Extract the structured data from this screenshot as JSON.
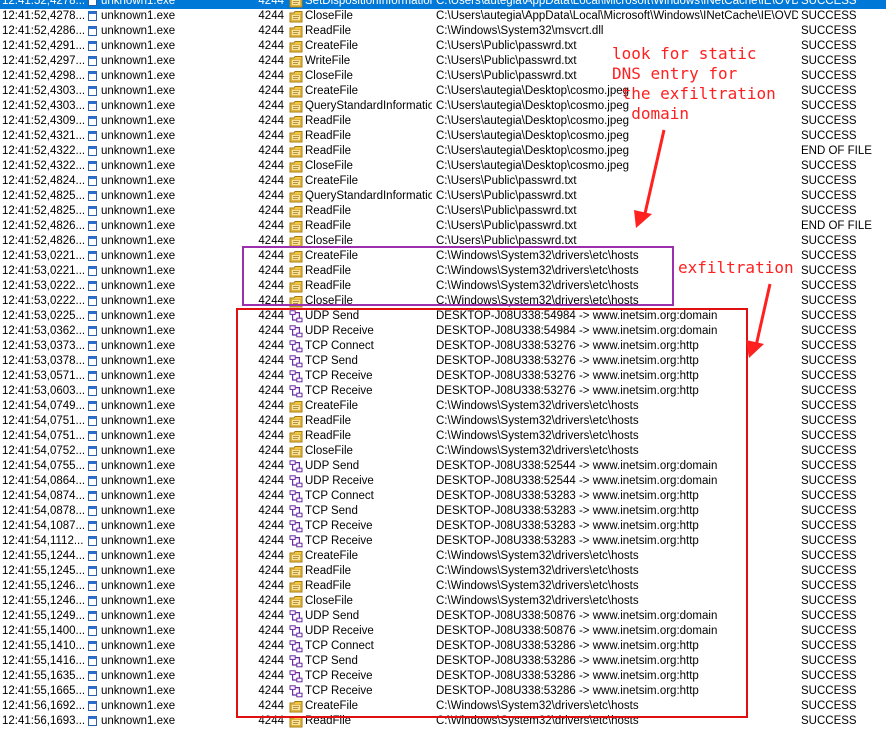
{
  "colors": {
    "selection": "#0078d7",
    "annotation": "#ff2020",
    "purple_box": "#9b2fae",
    "red_box": "#e01010"
  },
  "annotations": {
    "static_dns_note": "look for static\nDNS entry for\n the exfiltration\n  domain",
    "exfiltration_note": "exfiltration"
  },
  "events": [
    {
      "time": "12:41:52,4278...",
      "process": "unknown1.exe",
      "pid": "4244",
      "operation": "SetDispositionInformationEx",
      "path": "C:\\Users\\autegia\\AppData\\Local\\Microsoft\\Windows\\INetCache\\IE\\OVD...",
      "result": "SUCCESS",
      "icon": "file-icon",
      "selected": true
    },
    {
      "time": "12:41:52,4278...",
      "process": "unknown1.exe",
      "pid": "4244",
      "operation": "CloseFile",
      "path": "C:\\Users\\autegia\\AppData\\Local\\Microsoft\\Windows\\INetCache\\IE\\OVD...",
      "result": "SUCCESS",
      "icon": "file-icon"
    },
    {
      "time": "12:41:52,4286...",
      "process": "unknown1.exe",
      "pid": "4244",
      "operation": "ReadFile",
      "path": "C:\\Windows\\System32\\msvcrt.dll",
      "result": "SUCCESS",
      "icon": "file-icon"
    },
    {
      "time": "12:41:52,4291...",
      "process": "unknown1.exe",
      "pid": "4244",
      "operation": "CreateFile",
      "path": "C:\\Users\\Public\\passwrd.txt",
      "result": "SUCCESS",
      "icon": "file-icon"
    },
    {
      "time": "12:41:52,4297...",
      "process": "unknown1.exe",
      "pid": "4244",
      "operation": "WriteFile",
      "path": "C:\\Users\\Public\\passwrd.txt",
      "result": "SUCCESS",
      "icon": "file-icon"
    },
    {
      "time": "12:41:52,4298...",
      "process": "unknown1.exe",
      "pid": "4244",
      "operation": "CloseFile",
      "path": "C:\\Users\\Public\\passwrd.txt",
      "result": "SUCCESS",
      "icon": "file-icon"
    },
    {
      "time": "12:41:52,4303...",
      "process": "unknown1.exe",
      "pid": "4244",
      "operation": "CreateFile",
      "path": "C:\\Users\\autegia\\Desktop\\cosmo.jpeg",
      "result": "SUCCESS",
      "icon": "file-icon"
    },
    {
      "time": "12:41:52,4303...",
      "process": "unknown1.exe",
      "pid": "4244",
      "operation": "QueryStandardInformatio...",
      "path": "C:\\Users\\autegia\\Desktop\\cosmo.jpeg",
      "result": "SUCCESS",
      "icon": "file-icon"
    },
    {
      "time": "12:41:52,4309...",
      "process": "unknown1.exe",
      "pid": "4244",
      "operation": "ReadFile",
      "path": "C:\\Users\\autegia\\Desktop\\cosmo.jpeg",
      "result": "SUCCESS",
      "icon": "file-icon"
    },
    {
      "time": "12:41:52,4321...",
      "process": "unknown1.exe",
      "pid": "4244",
      "operation": "ReadFile",
      "path": "C:\\Users\\autegia\\Desktop\\cosmo.jpeg",
      "result": "SUCCESS",
      "icon": "file-icon"
    },
    {
      "time": "12:41:52,4322...",
      "process": "unknown1.exe",
      "pid": "4244",
      "operation": "ReadFile",
      "path": "C:\\Users\\autegia\\Desktop\\cosmo.jpeg",
      "result": "END OF FILE",
      "icon": "file-icon"
    },
    {
      "time": "12:41:52,4322...",
      "process": "unknown1.exe",
      "pid": "4244",
      "operation": "CloseFile",
      "path": "C:\\Users\\autegia\\Desktop\\cosmo.jpeg",
      "result": "SUCCESS",
      "icon": "file-icon"
    },
    {
      "time": "12:41:52,4824...",
      "process": "unknown1.exe",
      "pid": "4244",
      "operation": "CreateFile",
      "path": "C:\\Users\\Public\\passwrd.txt",
      "result": "SUCCESS",
      "icon": "file-icon"
    },
    {
      "time": "12:41:52,4825...",
      "process": "unknown1.exe",
      "pid": "4244",
      "operation": "QueryStandardInformatio...",
      "path": "C:\\Users\\Public\\passwrd.txt",
      "result": "SUCCESS",
      "icon": "file-icon"
    },
    {
      "time": "12:41:52,4825...",
      "process": "unknown1.exe",
      "pid": "4244",
      "operation": "ReadFile",
      "path": "C:\\Users\\Public\\passwrd.txt",
      "result": "SUCCESS",
      "icon": "file-icon"
    },
    {
      "time": "12:41:52,4826...",
      "process": "unknown1.exe",
      "pid": "4244",
      "operation": "ReadFile",
      "path": "C:\\Users\\Public\\passwrd.txt",
      "result": "END OF FILE",
      "icon": "file-icon"
    },
    {
      "time": "12:41:52,4826...",
      "process": "unknown1.exe",
      "pid": "4244",
      "operation": "CloseFile",
      "path": "C:\\Users\\Public\\passwrd.txt",
      "result": "SUCCESS",
      "icon": "file-icon"
    },
    {
      "time": "12:41:53,0221...",
      "process": "unknown1.exe",
      "pid": "4244",
      "operation": "CreateFile",
      "path": "C:\\Windows\\System32\\drivers\\etc\\hosts",
      "result": "SUCCESS",
      "icon": "file-icon"
    },
    {
      "time": "12:41:53,0221...",
      "process": "unknown1.exe",
      "pid": "4244",
      "operation": "ReadFile",
      "path": "C:\\Windows\\System32\\drivers\\etc\\hosts",
      "result": "SUCCESS",
      "icon": "file-icon"
    },
    {
      "time": "12:41:53,0222...",
      "process": "unknown1.exe",
      "pid": "4244",
      "operation": "ReadFile",
      "path": "C:\\Windows\\System32\\drivers\\etc\\hosts",
      "result": "SUCCESS",
      "icon": "file-icon"
    },
    {
      "time": "12:41:53,0222...",
      "process": "unknown1.exe",
      "pid": "4244",
      "operation": "CloseFile",
      "path": "C:\\Windows\\System32\\drivers\\etc\\hosts",
      "result": "SUCCESS",
      "icon": "file-icon"
    },
    {
      "time": "12:41:53,0225...",
      "process": "unknown1.exe",
      "pid": "4244",
      "operation": "UDP Send",
      "path": "DESKTOP-J08U338:54984 -> www.inetsim.org:domain",
      "result": "SUCCESS",
      "icon": "network-icon"
    },
    {
      "time": "12:41:53,0362...",
      "process": "unknown1.exe",
      "pid": "4244",
      "operation": "UDP Receive",
      "path": "DESKTOP-J08U338:54984 -> www.inetsim.org:domain",
      "result": "SUCCESS",
      "icon": "network-icon"
    },
    {
      "time": "12:41:53,0373...",
      "process": "unknown1.exe",
      "pid": "4244",
      "operation": "TCP Connect",
      "path": "DESKTOP-J08U338:53276 -> www.inetsim.org:http",
      "result": "SUCCESS",
      "icon": "network-icon"
    },
    {
      "time": "12:41:53,0378...",
      "process": "unknown1.exe",
      "pid": "4244",
      "operation": "TCP Send",
      "path": "DESKTOP-J08U338:53276 -> www.inetsim.org:http",
      "result": "SUCCESS",
      "icon": "network-icon"
    },
    {
      "time": "12:41:53,0571...",
      "process": "unknown1.exe",
      "pid": "4244",
      "operation": "TCP Receive",
      "path": "DESKTOP-J08U338:53276 -> www.inetsim.org:http",
      "result": "SUCCESS",
      "icon": "network-icon"
    },
    {
      "time": "12:41:53,0603...",
      "process": "unknown1.exe",
      "pid": "4244",
      "operation": "TCP Receive",
      "path": "DESKTOP-J08U338:53276 -> www.inetsim.org:http",
      "result": "SUCCESS",
      "icon": "network-icon"
    },
    {
      "time": "12:41:54,0749...",
      "process": "unknown1.exe",
      "pid": "4244",
      "operation": "CreateFile",
      "path": "C:\\Windows\\System32\\drivers\\etc\\hosts",
      "result": "SUCCESS",
      "icon": "file-icon"
    },
    {
      "time": "12:41:54,0751...",
      "process": "unknown1.exe",
      "pid": "4244",
      "operation": "ReadFile",
      "path": "C:\\Windows\\System32\\drivers\\etc\\hosts",
      "result": "SUCCESS",
      "icon": "file-icon"
    },
    {
      "time": "12:41:54,0751...",
      "process": "unknown1.exe",
      "pid": "4244",
      "operation": "ReadFile",
      "path": "C:\\Windows\\System32\\drivers\\etc\\hosts",
      "result": "SUCCESS",
      "icon": "file-icon"
    },
    {
      "time": "12:41:54,0752...",
      "process": "unknown1.exe",
      "pid": "4244",
      "operation": "CloseFile",
      "path": "C:\\Windows\\System32\\drivers\\etc\\hosts",
      "result": "SUCCESS",
      "icon": "file-icon"
    },
    {
      "time": "12:41:54,0755...",
      "process": "unknown1.exe",
      "pid": "4244",
      "operation": "UDP Send",
      "path": "DESKTOP-J08U338:52544 -> www.inetsim.org:domain",
      "result": "SUCCESS",
      "icon": "network-icon"
    },
    {
      "time": "12:41:54,0864...",
      "process": "unknown1.exe",
      "pid": "4244",
      "operation": "UDP Receive",
      "path": "DESKTOP-J08U338:52544 -> www.inetsim.org:domain",
      "result": "SUCCESS",
      "icon": "network-icon"
    },
    {
      "time": "12:41:54,0874...",
      "process": "unknown1.exe",
      "pid": "4244",
      "operation": "TCP Connect",
      "path": "DESKTOP-J08U338:53283 -> www.inetsim.org:http",
      "result": "SUCCESS",
      "icon": "network-icon"
    },
    {
      "time": "12:41:54,0878...",
      "process": "unknown1.exe",
      "pid": "4244",
      "operation": "TCP Send",
      "path": "DESKTOP-J08U338:53283 -> www.inetsim.org:http",
      "result": "SUCCESS",
      "icon": "network-icon"
    },
    {
      "time": "12:41:54,1087...",
      "process": "unknown1.exe",
      "pid": "4244",
      "operation": "TCP Receive",
      "path": "DESKTOP-J08U338:53283 -> www.inetsim.org:http",
      "result": "SUCCESS",
      "icon": "network-icon"
    },
    {
      "time": "12:41:54,1112...",
      "process": "unknown1.exe",
      "pid": "4244",
      "operation": "TCP Receive",
      "path": "DESKTOP-J08U338:53283 -> www.inetsim.org:http",
      "result": "SUCCESS",
      "icon": "network-icon"
    },
    {
      "time": "12:41:55,1244...",
      "process": "unknown1.exe",
      "pid": "4244",
      "operation": "CreateFile",
      "path": "C:\\Windows\\System32\\drivers\\etc\\hosts",
      "result": "SUCCESS",
      "icon": "file-icon"
    },
    {
      "time": "12:41:55,1245...",
      "process": "unknown1.exe",
      "pid": "4244",
      "operation": "ReadFile",
      "path": "C:\\Windows\\System32\\drivers\\etc\\hosts",
      "result": "SUCCESS",
      "icon": "file-icon"
    },
    {
      "time": "12:41:55,1246...",
      "process": "unknown1.exe",
      "pid": "4244",
      "operation": "ReadFile",
      "path": "C:\\Windows\\System32\\drivers\\etc\\hosts",
      "result": "SUCCESS",
      "icon": "file-icon"
    },
    {
      "time": "12:41:55,1246...",
      "process": "unknown1.exe",
      "pid": "4244",
      "operation": "CloseFile",
      "path": "C:\\Windows\\System32\\drivers\\etc\\hosts",
      "result": "SUCCESS",
      "icon": "file-icon"
    },
    {
      "time": "12:41:55,1249...",
      "process": "unknown1.exe",
      "pid": "4244",
      "operation": "UDP Send",
      "path": "DESKTOP-J08U338:50876 -> www.inetsim.org:domain",
      "result": "SUCCESS",
      "icon": "network-icon"
    },
    {
      "time": "12:41:55,1400...",
      "process": "unknown1.exe",
      "pid": "4244",
      "operation": "UDP Receive",
      "path": "DESKTOP-J08U338:50876 -> www.inetsim.org:domain",
      "result": "SUCCESS",
      "icon": "network-icon"
    },
    {
      "time": "12:41:55,1410...",
      "process": "unknown1.exe",
      "pid": "4244",
      "operation": "TCP Connect",
      "path": "DESKTOP-J08U338:53286 -> www.inetsim.org:http",
      "result": "SUCCESS",
      "icon": "network-icon"
    },
    {
      "time": "12:41:55,1416...",
      "process": "unknown1.exe",
      "pid": "4244",
      "operation": "TCP Send",
      "path": "DESKTOP-J08U338:53286 -> www.inetsim.org:http",
      "result": "SUCCESS",
      "icon": "network-icon"
    },
    {
      "time": "12:41:55,1635...",
      "process": "unknown1.exe",
      "pid": "4244",
      "operation": "TCP Receive",
      "path": "DESKTOP-J08U338:53286 -> www.inetsim.org:http",
      "result": "SUCCESS",
      "icon": "network-icon"
    },
    {
      "time": "12:41:55,1665...",
      "process": "unknown1.exe",
      "pid": "4244",
      "operation": "TCP Receive",
      "path": "DESKTOP-J08U338:53286 -> www.inetsim.org:http",
      "result": "SUCCESS",
      "icon": "network-icon"
    },
    {
      "time": "12:41:56,1692...",
      "process": "unknown1.exe",
      "pid": "4244",
      "operation": "CreateFile",
      "path": "C:\\Windows\\System32\\drivers\\etc\\hosts",
      "result": "SUCCESS",
      "icon": "file-icon"
    },
    {
      "time": "12:41:56,1693...",
      "process": "unknown1.exe",
      "pid": "4244",
      "operation": "ReadFile",
      "path": "C:\\Windows\\System32\\drivers\\etc\\hosts",
      "result": "SUCCESS",
      "icon": "file-icon"
    }
  ]
}
